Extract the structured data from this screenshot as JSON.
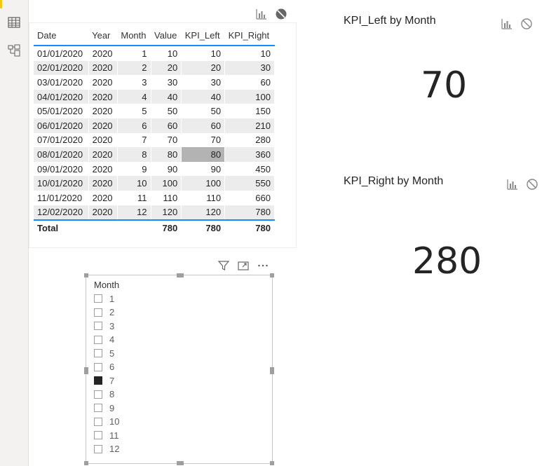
{
  "sidebar": {
    "items": [
      {
        "name": "table-view",
        "icon": "table-icon"
      },
      {
        "name": "model-view",
        "icon": "model-icon"
      }
    ]
  },
  "table_visual": {
    "columns": [
      "Date",
      "Year",
      "Month",
      "Value",
      "KPI_Left",
      "KPI_Right"
    ],
    "rows": [
      [
        "01/01/2020",
        "2020",
        "1",
        "10",
        "10",
        "10"
      ],
      [
        "02/01/2020",
        "2020",
        "2",
        "20",
        "20",
        "30"
      ],
      [
        "03/01/2020",
        "2020",
        "3",
        "30",
        "30",
        "60"
      ],
      [
        "04/01/2020",
        "2020",
        "4",
        "40",
        "40",
        "100"
      ],
      [
        "05/01/2020",
        "2020",
        "5",
        "50",
        "50",
        "150"
      ],
      [
        "06/01/2020",
        "2020",
        "6",
        "60",
        "60",
        "210"
      ],
      [
        "07/01/2020",
        "2020",
        "7",
        "70",
        "70",
        "280"
      ],
      [
        "08/01/2020",
        "2020",
        "8",
        "80",
        "80",
        "360"
      ],
      [
        "09/01/2020",
        "2020",
        "9",
        "90",
        "90",
        "450"
      ],
      [
        "10/01/2020",
        "2020",
        "10",
        "100",
        "100",
        "550"
      ],
      [
        "11/01/2020",
        "2020",
        "11",
        "110",
        "110",
        "660"
      ],
      [
        "12/02/2020",
        "2020",
        "12",
        "120",
        "120",
        "780"
      ]
    ],
    "total": {
      "label": "Total",
      "value": "780",
      "kpi_left": "780",
      "kpi_right": "780"
    },
    "highlighted_cell": {
      "row": 7,
      "col": 4
    }
  },
  "slicer": {
    "title": "Month",
    "items": [
      "1",
      "2",
      "3",
      "4",
      "5",
      "6",
      "7",
      "8",
      "9",
      "10",
      "11",
      "12"
    ],
    "selected": "7"
  },
  "cards": {
    "kpi_left": {
      "title": "KPI_Left by Month",
      "value": "70"
    },
    "kpi_right": {
      "title": "KPI_Right by Month",
      "value": "280"
    }
  },
  "colors": {
    "accent": "#118dff",
    "rail_accent": "#f2c811",
    "highlight": "#b3b3b3"
  }
}
